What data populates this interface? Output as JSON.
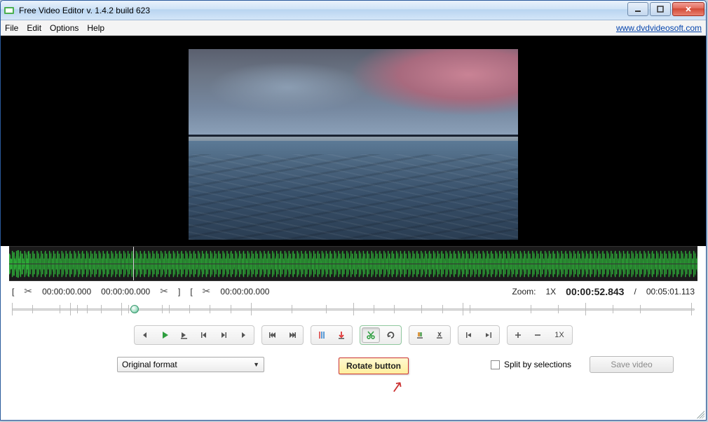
{
  "window": {
    "title": "Free Video Editor v. 1.4.2 build 623"
  },
  "menubar": {
    "items": [
      "File",
      "Edit",
      "Options",
      "Help"
    ],
    "url": "www.dvdvideosoft.com"
  },
  "markers": {
    "sel_start": "00:00:00.000",
    "sel_end": "00:00:00.000",
    "cut_start": "00:00:00.000"
  },
  "zoom": {
    "label": "Zoom:",
    "value": "1X"
  },
  "time": {
    "current": "00:00:52.843",
    "sep": "/",
    "total": "00:05:01.113"
  },
  "toolbar": {
    "speed": "1X"
  },
  "bottom": {
    "format_select": "Original format",
    "tooltip": "Rotate button",
    "split_label": "Split by selections",
    "save_label": "Save video"
  }
}
